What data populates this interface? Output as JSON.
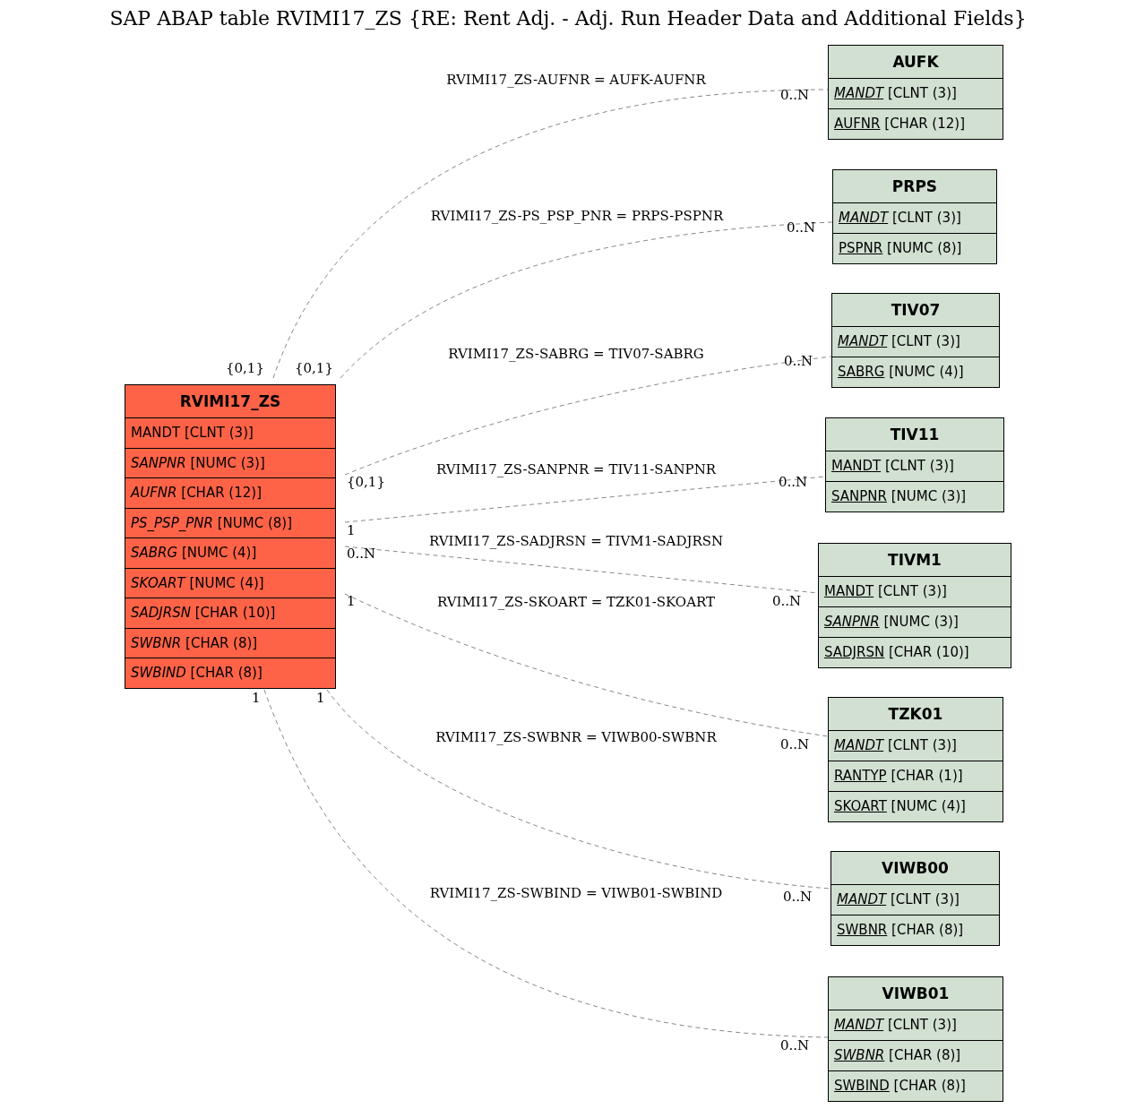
{
  "title": "SAP ABAP table RVIMI17_ZS {RE: Rent Adj. - Adj. Run Header Data and Additional Fields}",
  "tables": [
    {
      "name": "RVIMI17_ZS",
      "color": "#ff6347",
      "fields": [
        {
          "name": "MANDT",
          "type": "[CLNT (3)]",
          "italic": false,
          "key": false
        },
        {
          "name": "SANPNR",
          "type": "[NUMC (3)]",
          "italic": true,
          "key": false
        },
        {
          "name": "AUFNR",
          "type": "[CHAR (12)]",
          "italic": true,
          "key": false
        },
        {
          "name": "PS_PSP_PNR",
          "type": "[NUMC (8)]",
          "italic": true,
          "key": false
        },
        {
          "name": "SABRG",
          "type": "[NUMC (4)]",
          "italic": true,
          "key": false
        },
        {
          "name": "SKOART",
          "type": "[NUMC (4)]",
          "italic": true,
          "key": false
        },
        {
          "name": "SADJRSN",
          "type": "[CHAR (10)]",
          "italic": true,
          "key": false
        },
        {
          "name": "SWBNR",
          "type": "[CHAR (8)]",
          "italic": true,
          "key": false
        },
        {
          "name": "SWBIND",
          "type": "[CHAR (8)]",
          "italic": true,
          "key": false
        }
      ]
    },
    {
      "name": "AUFK",
      "color": "#d1e0d1",
      "fields": [
        {
          "name": "MANDT",
          "type": "[CLNT (3)]",
          "italic": true,
          "key": true
        },
        {
          "name": "AUFNR",
          "type": "[CHAR (12)]",
          "italic": false,
          "key": true
        }
      ]
    },
    {
      "name": "PRPS",
      "color": "#d1e0d1",
      "fields": [
        {
          "name": "MANDT",
          "type": "[CLNT (3)]",
          "italic": true,
          "key": true
        },
        {
          "name": "PSPNR",
          "type": "[NUMC (8)]",
          "italic": false,
          "key": true
        }
      ]
    },
    {
      "name": "TIV07",
      "color": "#d1e0d1",
      "fields": [
        {
          "name": "MANDT",
          "type": "[CLNT (3)]",
          "italic": true,
          "key": true
        },
        {
          "name": "SABRG",
          "type": "[NUMC (4)]",
          "italic": false,
          "key": true
        }
      ]
    },
    {
      "name": "TIV11",
      "color": "#d1e0d1",
      "fields": [
        {
          "name": "MANDT",
          "type": "[CLNT (3)]",
          "italic": false,
          "key": true
        },
        {
          "name": "SANPNR",
          "type": "[NUMC (3)]",
          "italic": false,
          "key": true
        }
      ]
    },
    {
      "name": "TIVM1",
      "color": "#d1e0d1",
      "fields": [
        {
          "name": "MANDT",
          "type": "[CLNT (3)]",
          "italic": false,
          "key": true
        },
        {
          "name": "SANPNR",
          "type": "[NUMC (3)]",
          "italic": true,
          "key": true
        },
        {
          "name": "SADJRSN",
          "type": "[CHAR (10)]",
          "italic": false,
          "key": true
        }
      ]
    },
    {
      "name": "TZK01",
      "color": "#d1e0d1",
      "fields": [
        {
          "name": "MANDT",
          "type": "[CLNT (3)]",
          "italic": true,
          "key": true
        },
        {
          "name": "RANTYP",
          "type": "[CHAR (1)]",
          "italic": false,
          "key": true
        },
        {
          "name": "SKOART",
          "type": "[NUMC (4)]",
          "italic": false,
          "key": true
        }
      ]
    },
    {
      "name": "VIWB00",
      "color": "#d1e0d1",
      "fields": [
        {
          "name": "MANDT",
          "type": "[CLNT (3)]",
          "italic": true,
          "key": true
        },
        {
          "name": "SWBNR",
          "type": "[CHAR (8)]",
          "italic": false,
          "key": true
        }
      ]
    },
    {
      "name": "VIWB01",
      "color": "#d1e0d1",
      "fields": [
        {
          "name": "MANDT",
          "type": "[CLNT (3)]",
          "italic": true,
          "key": true
        },
        {
          "name": "SWBNR",
          "type": "[CHAR (8)]",
          "italic": true,
          "key": true
        },
        {
          "name": "SWBIND",
          "type": "[CHAR (8)]",
          "italic": false,
          "key": true
        }
      ]
    }
  ],
  "relations": [
    {
      "label": "RVIMI17_ZS-AUFNR = AUFK-AUFNR",
      "source_cardinality": "{0,1}",
      "target_cardinality": "0..N"
    },
    {
      "label": "RVIMI17_ZS-PS_PSP_PNR = PRPS-PSPNR",
      "source_cardinality": "{0,1}",
      "target_cardinality": "0..N"
    },
    {
      "label": "RVIMI17_ZS-SABRG = TIV07-SABRG",
      "source_cardinality": "{0,1}",
      "target_cardinality": "0..N"
    },
    {
      "label": "RVIMI17_ZS-SANPNR = TIV11-SANPNR",
      "source_cardinality": "1",
      "target_cardinality": "0..N"
    },
    {
      "label": "RVIMI17_ZS-SADJRSN = TIVM1-SADJRSN",
      "source_cardinality": "0..N",
      "target_cardinality": "0..N"
    },
    {
      "label": "RVIMI17_ZS-SKOART = TZK01-SKOART",
      "source_cardinality": "1",
      "target_cardinality": "0..N"
    },
    {
      "label": "RVIMI17_ZS-SWBNR = VIWB00-SWBNR",
      "source_cardinality": "1",
      "target_cardinality": "0..N"
    },
    {
      "label": "RVIMI17_ZS-SWBIND = VIWB01-SWBIND",
      "source_cardinality": "1",
      "target_cardinality": "0..N"
    }
  ]
}
